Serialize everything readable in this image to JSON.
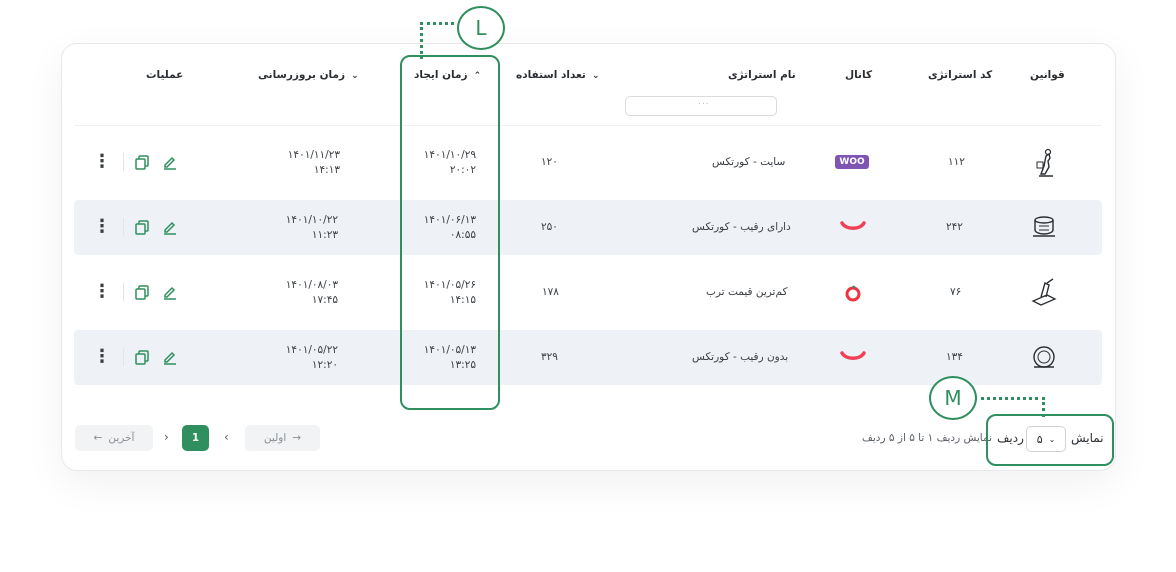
{
  "columns": {
    "rules": "قوانین",
    "strategy_code": "کد استراتژی",
    "channel": "کانال",
    "strategy_name": "نام استراتژی",
    "usage_count": "تعداد استفاده",
    "created_time": "زمان ایجاد",
    "updated_time": "زمان بروزرسانی",
    "actions": "عملیات"
  },
  "search_placeholder": "...",
  "rows": [
    {
      "code": "۱۱۲",
      "channel_icon": "woo-logo-icon",
      "channel_logo_text": "WOO",
      "name": "سایت - کورتکس",
      "usage": "۱۲۰",
      "created_date": "۱۴۰۱/۱۰/۲۹",
      "created_time": "۲۰:۰۲",
      "updated_date": "۱۴۰۱/۱۱/۲۳",
      "updated_time": "۱۴:۱۳"
    },
    {
      "code": "۲۴۲",
      "channel_icon": "digikala-smile-icon",
      "name": "دارای رقیب - کورتکس",
      "usage": "۲۵۰",
      "created_date": "۱۴۰۱/۰۶/۱۳",
      "created_time": "۰۸:۵۵",
      "updated_date": "۱۴۰۱/۱۰/۲۲",
      "updated_time": "۱۱:۲۳"
    },
    {
      "code": "۷۶",
      "channel_icon": "torob-ring-icon",
      "name": "کم‌ترین قیمت ترب",
      "usage": "۱۷۸",
      "created_date": "۱۴۰۱/۰۵/۲۶",
      "created_time": "۱۴:۱۵",
      "updated_date": "۱۴۰۱/۰۸/۰۳",
      "updated_time": "۱۷:۴۵"
    },
    {
      "code": "۱۳۴",
      "channel_icon": "digikala-smile-icon",
      "name": "بدون رقیب - کورتکس",
      "usage": "۳۲۹",
      "created_date": "۱۴۰۱/۰۵/۱۳",
      "created_time": "۱۳:۲۵",
      "updated_date": "۱۴۰۱/۰۵/۲۲",
      "updated_time": "۱۲:۲۰"
    }
  ],
  "pagination": {
    "last_label": "آخرین",
    "first_label": "اولین",
    "current_page": "1",
    "summary": "نمایش ردیف ۱ تا ۵ از ۵ ردیف",
    "show_label": "نمایش",
    "rows_label": "ردیف",
    "page_size": "۵"
  },
  "callouts": {
    "L": "L",
    "M": "M"
  },
  "colors": {
    "accent": "#2f8f5e",
    "digikala": "#ef4056",
    "woo": "#7f54b3",
    "alt_row": "#eef1f5"
  }
}
